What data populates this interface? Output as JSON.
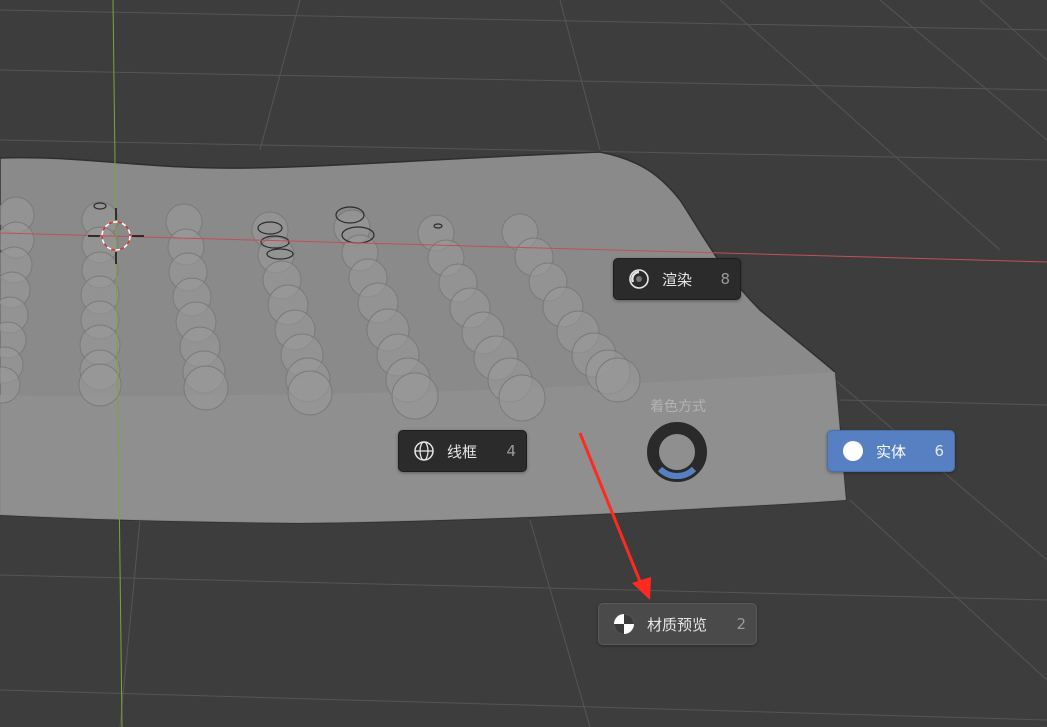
{
  "pie_menu": {
    "title": "着色方式",
    "items": [
      {
        "id": "rendered",
        "label": "渲染",
        "hotkey": "8",
        "icon": "rendered-sphere-icon",
        "state": "normal"
      },
      {
        "id": "wireframe",
        "label": "线框",
        "hotkey": "4",
        "icon": "wireframe-globe-icon",
        "state": "normal"
      },
      {
        "id": "solid",
        "label": "实体",
        "hotkey": "6",
        "icon": "solid-circle-icon",
        "state": "active"
      },
      {
        "id": "material",
        "label": "材质预览",
        "hotkey": "2",
        "icon": "material-preview-sphere-icon",
        "state": "hover"
      }
    ],
    "direction_indicator": "bottom"
  },
  "colors": {
    "viewport_bg": "#3d3d3d",
    "grid_line": "#555555",
    "x_axis": "#c0505a",
    "y_axis": "#7fa33a",
    "active_item": "#5680c2",
    "menu_item_bg": "#2b2b2b",
    "annotation_arrow": "#ff2a1f"
  }
}
